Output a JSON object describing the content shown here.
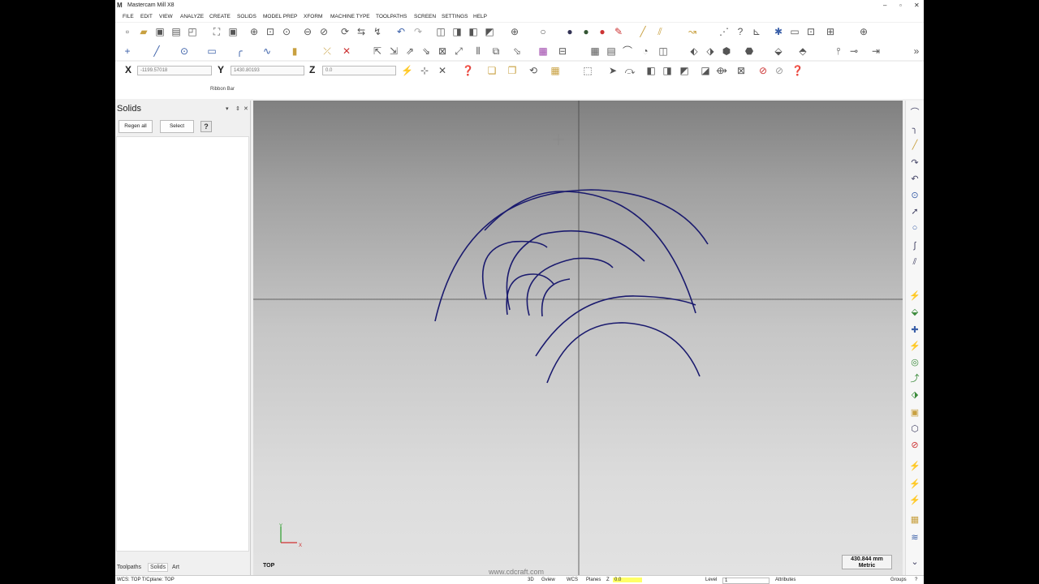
{
  "window": {
    "title": "Mastercam Mill X8",
    "controls": [
      "–",
      "▫",
      "✕"
    ]
  },
  "menu": [
    "FILE",
    "EDIT",
    "VIEW",
    "ANALYZE",
    "CREATE",
    "SOLIDS",
    "MODEL PREP",
    "XFORM",
    "MACHINE TYPE",
    "TOOLPATHS",
    "SCREEN",
    "SETTINGS",
    "HELP"
  ],
  "ribbon": {
    "x_label": "X",
    "x_value": "-1199.57018",
    "y_label": "Y",
    "y_value": "1430.80193",
    "z_label": "Z",
    "z_value": "0.0",
    "bar_label": "Ribbon Bar"
  },
  "icons": {
    "toolbar1": [
      "new-file-icon",
      "open-file-icon",
      "save-icon",
      "print-icon",
      "print-preview-icon",
      "fit-icon",
      "zoom-window-icon",
      "zoom-target-icon",
      "zoom-icon",
      "unzoom-icon",
      "zoom-out-icon",
      "dynamic-rotate-icon",
      "repaint-icon",
      "undo-icon",
      "redo-icon",
      "top-view-icon",
      "front-view-icon",
      "right-view-icon",
      "iso-view-icon",
      "wireframe-sphere-icon",
      "shaded-sphere-icon",
      "solid-sphere-icon",
      "shaded-solid-icon",
      "delete-entities-icon",
      "line-icon",
      "trim-icon",
      "chain-icon",
      "analyze-icon",
      "lock-icon"
    ],
    "right": [
      "arc-icon",
      "fillet-icon",
      "line-icon",
      "arc-tangent-icon",
      "point-icon",
      "circle-icon",
      "pointer-icon",
      "circle-edge-icon",
      "spline-icon",
      "offset-icon",
      "toolpath-icon",
      "contour-icon",
      "drill-icon",
      "pocket-icon",
      "circle-mill-icon",
      "chamfer-icon",
      "surface-icon",
      "stock-icon",
      "solid-icon",
      "cancel-icon",
      "plane-icon",
      "stack-icon",
      "tree-icon",
      "layers-icon",
      "chevron-icon"
    ]
  },
  "panel": {
    "title": "Solids",
    "pin": "▾",
    "autohide": "⇕",
    "close": "✕",
    "regen_label": "Regen all",
    "select_label": "Select",
    "help_label": "?",
    "tabs": [
      "Toolpaths",
      "Solids",
      "Art"
    ]
  },
  "viewport": {
    "view_label": "TOP",
    "axis_y": "Y",
    "axis_x": "X",
    "scale_value": "430.844 mm",
    "scale_unit": "Metric",
    "watermark": "www.cdcraft.com"
  },
  "status": {
    "wcs": "WCS: TOP  T/Cplane: TOP",
    "mode_3d": "3D",
    "gview": "Gview",
    "wcs_btn": "WCS",
    "planes": "Planes",
    "z_label": "Z",
    "z_value": "0.0",
    "level_label": "Level",
    "level_value": "1",
    "attributes": "Attributes",
    "groups": "Groups",
    "help": "?"
  },
  "colors": {
    "curve": "#1a1a6e",
    "axis_y": "#2a9d2a",
    "axis_x": "#d03030"
  }
}
